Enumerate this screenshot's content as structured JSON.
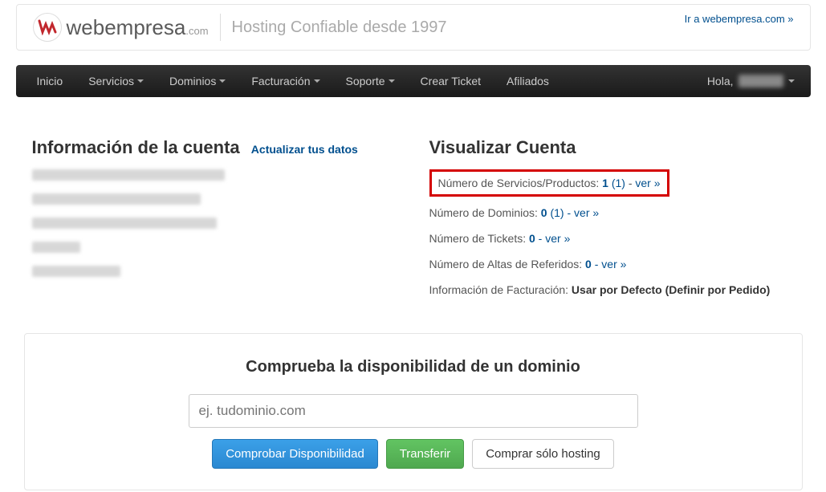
{
  "header": {
    "logo_main": "webempresa",
    "logo_tld": ".com",
    "tagline": "Hosting Confiable desde 1997",
    "toplink": "Ir a webempresa.com »"
  },
  "nav": {
    "items": [
      {
        "label": "Inicio",
        "dropdown": false
      },
      {
        "label": "Servicios",
        "dropdown": true
      },
      {
        "label": "Dominios",
        "dropdown": true
      },
      {
        "label": "Facturación",
        "dropdown": true
      },
      {
        "label": "Soporte",
        "dropdown": true
      },
      {
        "label": "Crear Ticket",
        "dropdown": false
      },
      {
        "label": "Afiliados",
        "dropdown": false
      }
    ],
    "greeting": "Hola,"
  },
  "account_info": {
    "heading": "Información de la cuenta",
    "update_link": "Actualizar tus datos"
  },
  "account_view": {
    "heading": "Visualizar Cuenta",
    "rows": [
      {
        "label": "Número de Servicios/Productos: ",
        "num": "1",
        "paren": " (1) ",
        "dash": "- ",
        "link": "ver »",
        "highlight": true
      },
      {
        "label": "Número de Dominios: ",
        "num": "0",
        "paren": " (1) - ",
        "dash": "",
        "link": "ver »",
        "highlight": false
      },
      {
        "label": "Número de Tickets: ",
        "num": "0",
        "paren": " - ",
        "dash": "",
        "link": "ver »",
        "highlight": false
      },
      {
        "label": "Número de Altas de Referidos: ",
        "num": "0",
        "paren": " - ",
        "dash": "",
        "link": "ver »",
        "highlight": false
      }
    ],
    "billing_label": "Información de Facturación: ",
    "billing_value": "Usar por Defecto (Definir por Pedido)"
  },
  "domain_check": {
    "heading": "Comprueba la disponibilidad de un dominio",
    "placeholder": "ej. tudominio.com",
    "btn_check": "Comprobar Disponibilidad",
    "btn_transfer": "Transferir",
    "btn_hosting": "Comprar sólo hosting"
  }
}
